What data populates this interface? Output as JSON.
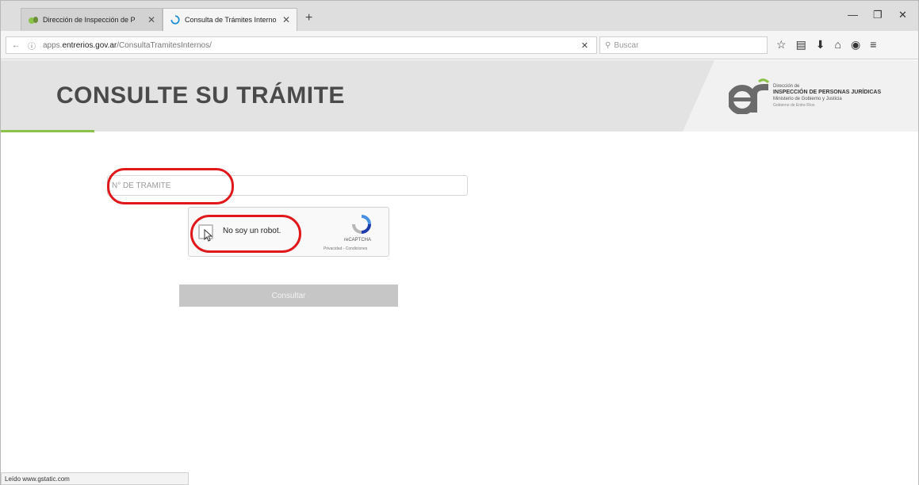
{
  "browser": {
    "tabs": [
      {
        "label": "Dirección de Inspección de P",
        "favicon": "er-logo-icon"
      },
      {
        "label": "Consulta de Trámites Interno",
        "favicon": "loading-spinner-icon"
      }
    ],
    "url_prefix": "apps.",
    "url_domain": "entrerios.gov.ar",
    "url_path": "/ConsultaTramitesInternos/",
    "search_placeholder": "Buscar"
  },
  "page": {
    "title": "CONSULTE SU TRÁMITE",
    "logo": {
      "line1": "Dirección de",
      "line2": "INSPECCIÓN DE PERSONAS JURÍDICAS",
      "line3": "Ministerio de Gobierno y Justicia",
      "line4": "Gobierno de Entre Ríos"
    },
    "tramite_placeholder": "N° DE TRAMITE",
    "recaptcha": {
      "label": "No soy un robot.",
      "brand": "reCAPTCHA",
      "links": "Privacidad - Condiciones"
    },
    "submit_label": "Consultar"
  },
  "status": {
    "text": "Leído www.gstatic.com"
  },
  "colors": {
    "accent_green": "#8bc34a",
    "annotation_red": "#e0181b",
    "banner_gray": "#e3e3e3"
  }
}
